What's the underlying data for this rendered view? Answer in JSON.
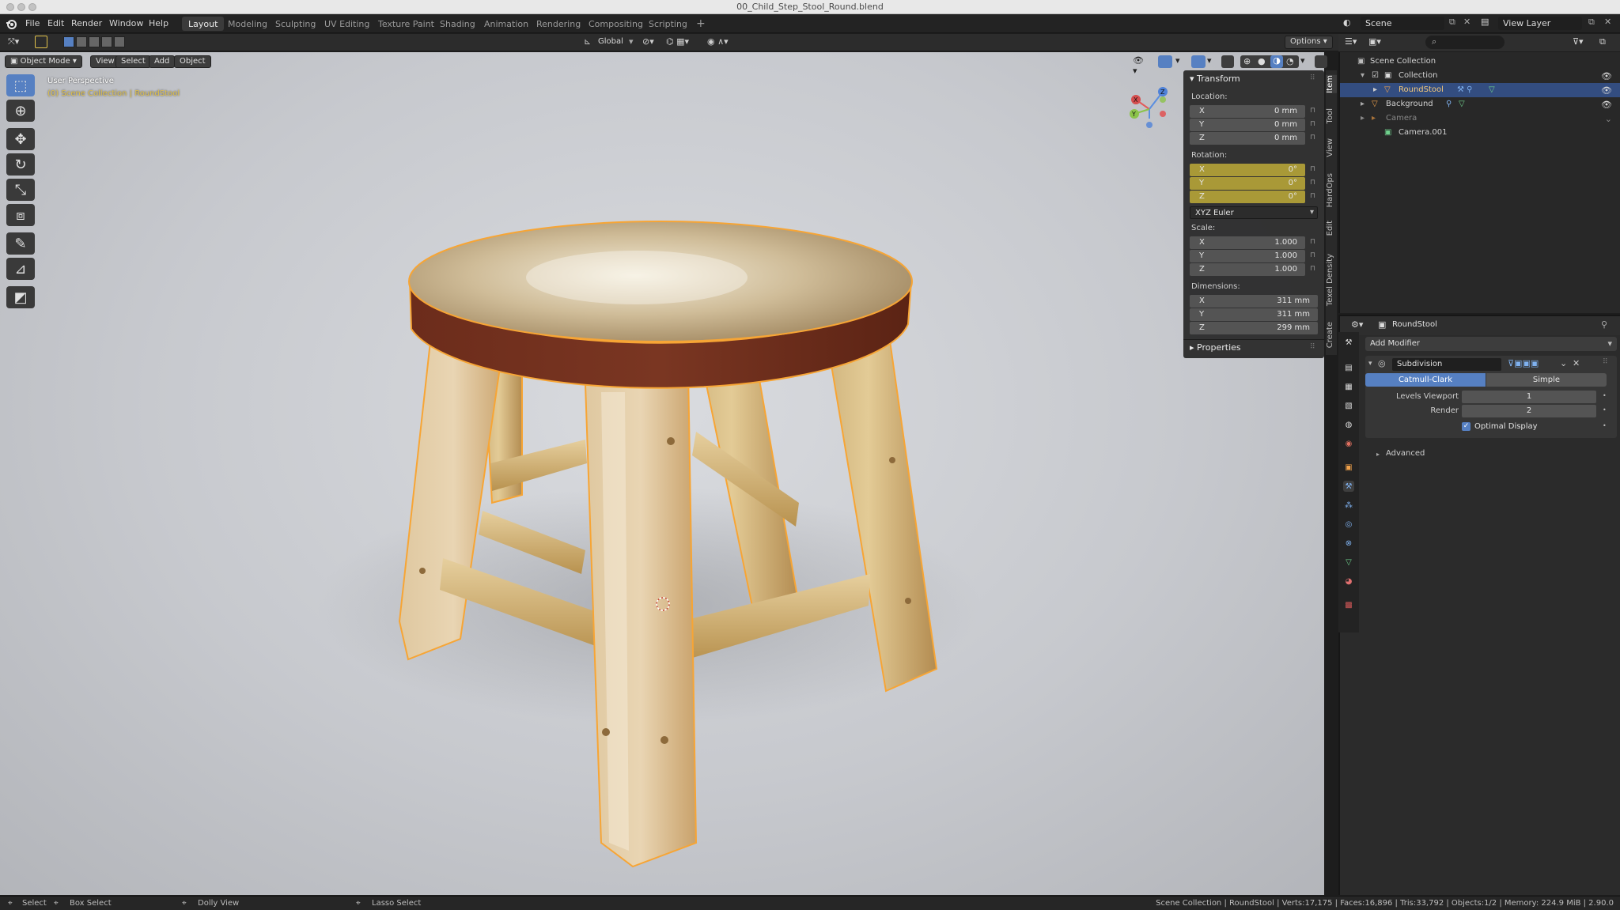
{
  "window": {
    "title": "00_Child_Step_Stool_Round.blend"
  },
  "menu": {
    "file": "File",
    "edit": "Edit",
    "render": "Render",
    "window": "Window",
    "help": "Help"
  },
  "workspaces": [
    "Layout",
    "Modeling",
    "Sculpting",
    "UV Editing",
    "Texture Paint",
    "Shading",
    "Animation",
    "Rendering",
    "Compositing",
    "Scripting"
  ],
  "header": {
    "orientation": "Global",
    "options": "Options",
    "scene": "Scene",
    "view_layer": "View Layer"
  },
  "viewport": {
    "mode": "Object Mode",
    "view": "View",
    "select": "Select",
    "add": "Add",
    "object": "Object",
    "perspective": "User Perspective",
    "collection_path": "(0) Scene Collection | RoundStool"
  },
  "npanel": {
    "transform": "Transform",
    "location_label": "Location:",
    "rotation_label": "Rotation:",
    "scale_label": "Scale:",
    "dimensions_label": "Dimensions:",
    "location": [
      {
        "axis": "X",
        "value": "0 mm"
      },
      {
        "axis": "Y",
        "value": "0 mm"
      },
      {
        "axis": "Z",
        "value": "0 mm"
      }
    ],
    "rotation": [
      {
        "axis": "X",
        "value": "0°"
      },
      {
        "axis": "Y",
        "value": "0°"
      },
      {
        "axis": "Z",
        "value": "0°"
      }
    ],
    "rotation_mode": "XYZ Euler",
    "scale": [
      {
        "axis": "X",
        "value": "1.000"
      },
      {
        "axis": "Y",
        "value": "1.000"
      },
      {
        "axis": "Z",
        "value": "1.000"
      }
    ],
    "dimensions": [
      {
        "axis": "X",
        "value": "311 mm"
      },
      {
        "axis": "Y",
        "value": "311 mm"
      },
      {
        "axis": "Z",
        "value": "299 mm"
      }
    ],
    "properties": "Properties",
    "tabs": [
      "Item",
      "Tool",
      "View",
      "HardOps",
      "Edit",
      "Texel Density",
      "Create"
    ]
  },
  "outliner": {
    "scene_collection": "Scene Collection",
    "collection": "Collection",
    "roundstool": "RoundStool",
    "background": "Background",
    "camera": "Camera",
    "camera001": "Camera.001"
  },
  "properties": {
    "object_name": "RoundStool",
    "add_modifier": "Add Modifier",
    "modifier_name": "Subdivision",
    "catmull": "Catmull-Clark",
    "simple": "Simple",
    "levels_viewport_label": "Levels Viewport",
    "levels_viewport": "1",
    "render_label": "Render",
    "render": "2",
    "optimal_display": "Optimal Display",
    "advanced": "Advanced"
  },
  "status": {
    "select": "Select",
    "box_select": "Box Select",
    "dolly_view": "Dolly View",
    "lasso_select": "Lasso Select",
    "stats": "Scene Collection | RoundStool | Verts:17,175 | Faces:16,896 | Tris:33,792 | Objects:1/2 | Memory: 224.9 MiB | 2.90.0"
  },
  "colors": {
    "selection_outline": "#f7a535",
    "accent_blue": "#5680c2",
    "field_yellow": "#a99937"
  }
}
